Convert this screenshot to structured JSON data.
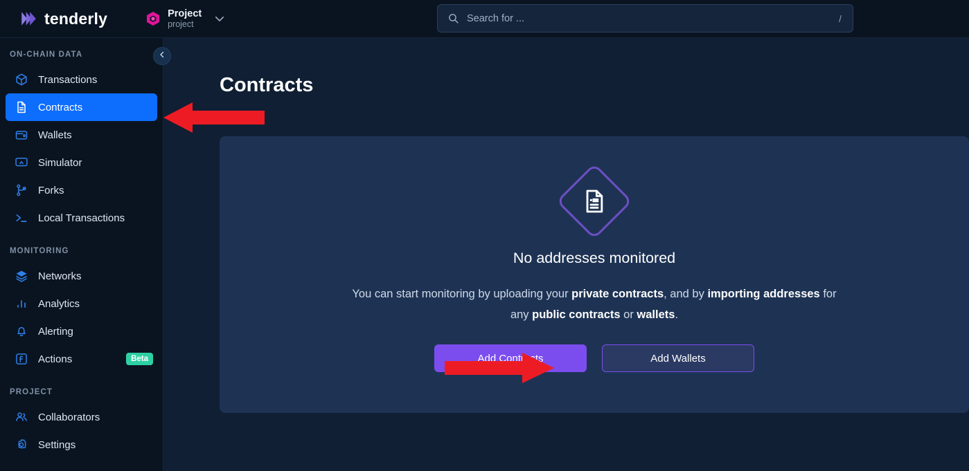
{
  "header": {
    "logo_text": "tenderly",
    "logo_icon": "tenderly-logo-mark",
    "project": {
      "icon": "hexagon-icon",
      "name": "Project",
      "subtitle": "project",
      "chevron_icon": "chevron-down-icon"
    },
    "search": {
      "icon": "search-icon",
      "placeholder": "Search for ...",
      "value": "",
      "shortcut": "/"
    }
  },
  "sidebar": {
    "collapse_icon": "chevron-left-icon",
    "sections": [
      {
        "label": "ON-CHAIN DATA",
        "items": [
          {
            "label": "Transactions",
            "icon": "cube-icon",
            "active": false
          },
          {
            "label": "Contracts",
            "icon": "document-icon",
            "active": true
          },
          {
            "label": "Wallets",
            "icon": "wallet-icon",
            "active": false
          },
          {
            "label": "Simulator",
            "icon": "monitor-icon",
            "active": false
          },
          {
            "label": "Forks",
            "icon": "fork-icon",
            "active": false
          },
          {
            "label": "Local Transactions",
            "icon": "terminal-icon",
            "active": false
          }
        ]
      },
      {
        "label": "MONITORING",
        "items": [
          {
            "label": "Networks",
            "icon": "layers-icon",
            "active": false
          },
          {
            "label": "Analytics",
            "icon": "bar-chart-icon",
            "active": false
          },
          {
            "label": "Alerting",
            "icon": "bell-icon",
            "active": false
          },
          {
            "label": "Actions",
            "icon": "function-icon",
            "active": false,
            "badge": "Beta"
          }
        ]
      },
      {
        "label": "PROJECT",
        "items": [
          {
            "label": "Collaborators",
            "icon": "users-icon",
            "active": false
          },
          {
            "label": "Settings",
            "icon": "gear-icon",
            "active": false
          }
        ]
      }
    ]
  },
  "main": {
    "page_title": "Contracts",
    "empty_state": {
      "illustration_icon": "document-in-diamond-icon",
      "title": "No addresses monitored",
      "description_parts": [
        {
          "text": "You can start monitoring by uploading your ",
          "bold": false
        },
        {
          "text": "private contracts",
          "bold": true
        },
        {
          "text": ", and by ",
          "bold": false
        },
        {
          "text": "importing addresses",
          "bold": true
        },
        {
          "text": " for any ",
          "bold": false
        },
        {
          "text": "public contracts",
          "bold": true
        },
        {
          "text": " or ",
          "bold": false
        },
        {
          "text": "wallets",
          "bold": true
        },
        {
          "text": ".",
          "bold": false
        }
      ],
      "primary_button": "Add Contracts",
      "secondary_button": "Add Wallets"
    }
  },
  "annotations": [
    {
      "name": "arrow-pointing-to-contracts-nav",
      "direction": "left",
      "color": "#ed1c24"
    },
    {
      "name": "arrow-pointing-to-add-contracts-button",
      "direction": "right",
      "color": "#ed1c24"
    }
  ],
  "colors": {
    "page_bg": "#101f33",
    "sidebar_bg": "#0a1420",
    "header_bg": "#0a1420",
    "card_bg": "#1e3354",
    "active_nav": "#0d6efd",
    "accent_purple": "#7c4dee",
    "badge_green": "#2ed0a3",
    "annotation_red": "#ed1c24"
  }
}
